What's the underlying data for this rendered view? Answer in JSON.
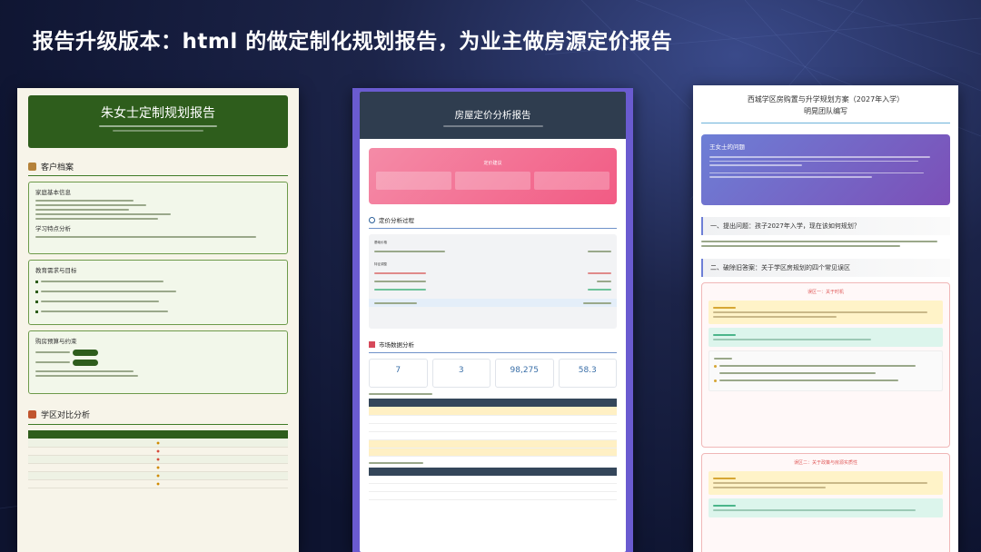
{
  "slide": {
    "title": "报告升级版本：html 的做定制化规划报告，为业主做房源定价报告"
  },
  "report1": {
    "title": "朱女士定制规划报告",
    "section_client": "客户档案",
    "box_basic": "家庭基本信息",
    "box_learning": "学习特点分析",
    "box_edu": "教育需求与目标",
    "box_budget": "购房预算与约束",
    "section_compare": "学区对比分析"
  },
  "report2": {
    "title": "房屋定价分析报告",
    "suggestion": "定价建议",
    "section_process": "定价分析过程",
    "basic_price_label": "基础价格",
    "adjust_label": "特征调整",
    "section_market": "市场数据分析",
    "stats": [
      {
        "value": "7"
      },
      {
        "value": "3"
      },
      {
        "value": "98,275"
      },
      {
        "value": "58.3"
      }
    ]
  },
  "report3": {
    "title_line1": "西城学区房购置与升学规划方案（2027年入学）",
    "title_line2": "明晃团队编写",
    "purple_title": "王女士的问题",
    "q1": "一、提出问题：孩子2027年入学，现在该如何规划？",
    "q2": "二、破除旧答案：关于学区房规划的四个常见误区",
    "myth1": "误区一：关于时机",
    "myth2": "误区二：关于政策与房源实质性"
  }
}
